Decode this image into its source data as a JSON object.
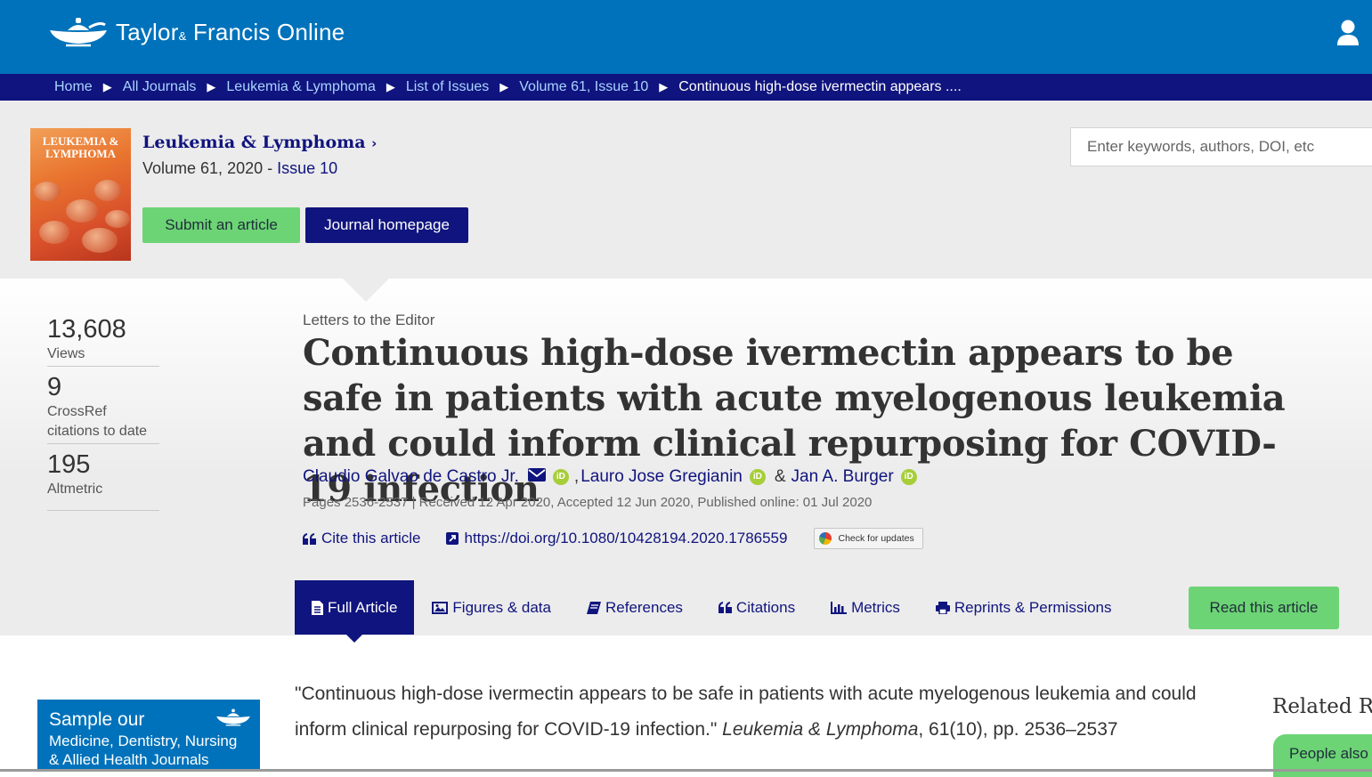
{
  "header": {
    "logo_main": "Taylor",
    "logo_amp": "&",
    "logo_rest": "Francis Online",
    "user_icon": "user-icon"
  },
  "breadcrumb": {
    "items": [
      "Home",
      "All Journals",
      "Leukemia & Lymphoma",
      "List of Issues",
      "Volume 61, Issue 10"
    ],
    "current": "Continuous high-dose ivermectin appears ...."
  },
  "journal": {
    "cover_title": "LEUKEMIA & LYMPHOMA",
    "name": "Leukemia & Lymphoma",
    "volume": "Volume 61, 2020 - ",
    "issue": "Issue 10",
    "submit_label": "Submit an article",
    "homepage_label": "Journal homepage",
    "search_placeholder": "Enter keywords, authors, DOI, etc"
  },
  "metrics": [
    {
      "value": "13,608",
      "label": "Views"
    },
    {
      "value": "9",
      "label": "CrossRef citations to date"
    },
    {
      "value": "195",
      "label": "Altmetric"
    }
  ],
  "article": {
    "type": "Letters to the Editor",
    "title": "Continuous high-dose ivermectin appears to be safe in patients with acute myelogenous leukemia and could inform clinical repurposing for COVID-19 infection",
    "authors": [
      "Claudio Galvao de Castro Jr.",
      "Lauro Jose Gregianin",
      "Jan A. Burger"
    ],
    "author_amp": "&",
    "orcid_label": "iD",
    "pub_info": "Pages 2536-2537 | Received 12 Apr 2020, Accepted 12 Jun 2020, Published online: 01 Jul 2020",
    "cite_label": "Cite this article",
    "doi": "https://doi.org/10.1080/10428194.2020.1786559",
    "check_updates": "Check for updates"
  },
  "tabs": [
    {
      "label": "Full Article",
      "icon": "document-icon",
      "active": true
    },
    {
      "label": "Figures & data",
      "icon": "image-icon"
    },
    {
      "label": "References",
      "icon": "book-icon"
    },
    {
      "label": "Citations",
      "icon": "quote-icon"
    },
    {
      "label": "Metrics",
      "icon": "bar-chart-icon"
    },
    {
      "label": "Reprints & Permissions",
      "icon": "print-icon"
    }
  ],
  "read_label": "Read this article",
  "ad": {
    "line1": "Sample our",
    "line2": "Medicine, Dentistry, Nursing",
    "line3": "& Allied Health Journals"
  },
  "citation": {
    "text1": "\"Continuous high-dose ivermectin appears to be safe in patients with acute myelogenous leukemia and could inform clinical repurposing for COVID-19 infection.\" ",
    "journal": "Leukemia & Lymphoma",
    "text2": ", 61(10), pp. 2536–2537"
  },
  "related": {
    "heading": "Related Re",
    "tab_label": "People also"
  },
  "colors": {
    "brand_blue": "#0072bb",
    "navy": "#10147e",
    "green": "#6cd475",
    "orcid_green": "#a6ce39"
  }
}
